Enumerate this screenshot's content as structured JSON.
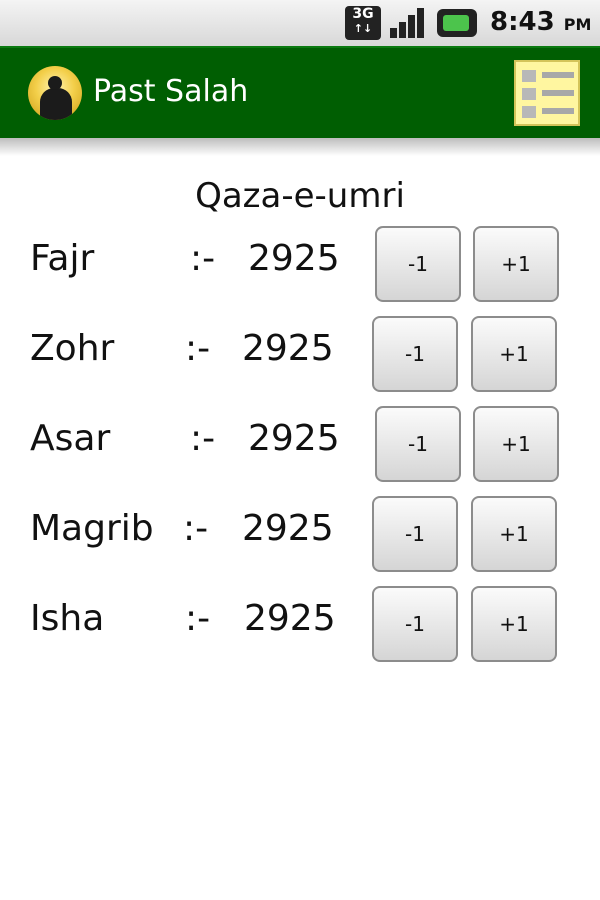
{
  "status_bar": {
    "network": "3G",
    "network_arrows": "↑↓",
    "time": "8:43",
    "ampm": "PM"
  },
  "app_bar": {
    "title": "Past Salah",
    "icon": "prayer-figure-icon",
    "menu_icon": "list-icon"
  },
  "main": {
    "heading": "Qaza-e-umri",
    "separator": ":-",
    "prayers": [
      {
        "name": "Fajr",
        "count": "2925",
        "minus_label": "-1",
        "plus_label": "+1"
      },
      {
        "name": "Zohr",
        "count": "2925",
        "minus_label": "-1",
        "plus_label": "+1"
      },
      {
        "name": "Asar",
        "count": "2925",
        "minus_label": "-1",
        "plus_label": "+1"
      },
      {
        "name": "Magrib",
        "count": "2925",
        "minus_label": "-1",
        "plus_label": "+1"
      },
      {
        "name": "Isha",
        "count": "2925",
        "minus_label": "-1",
        "plus_label": "+1"
      }
    ]
  },
  "colors": {
    "app_bar_bg": "#005e02",
    "menu_icon_bg": "#fff6a0"
  }
}
